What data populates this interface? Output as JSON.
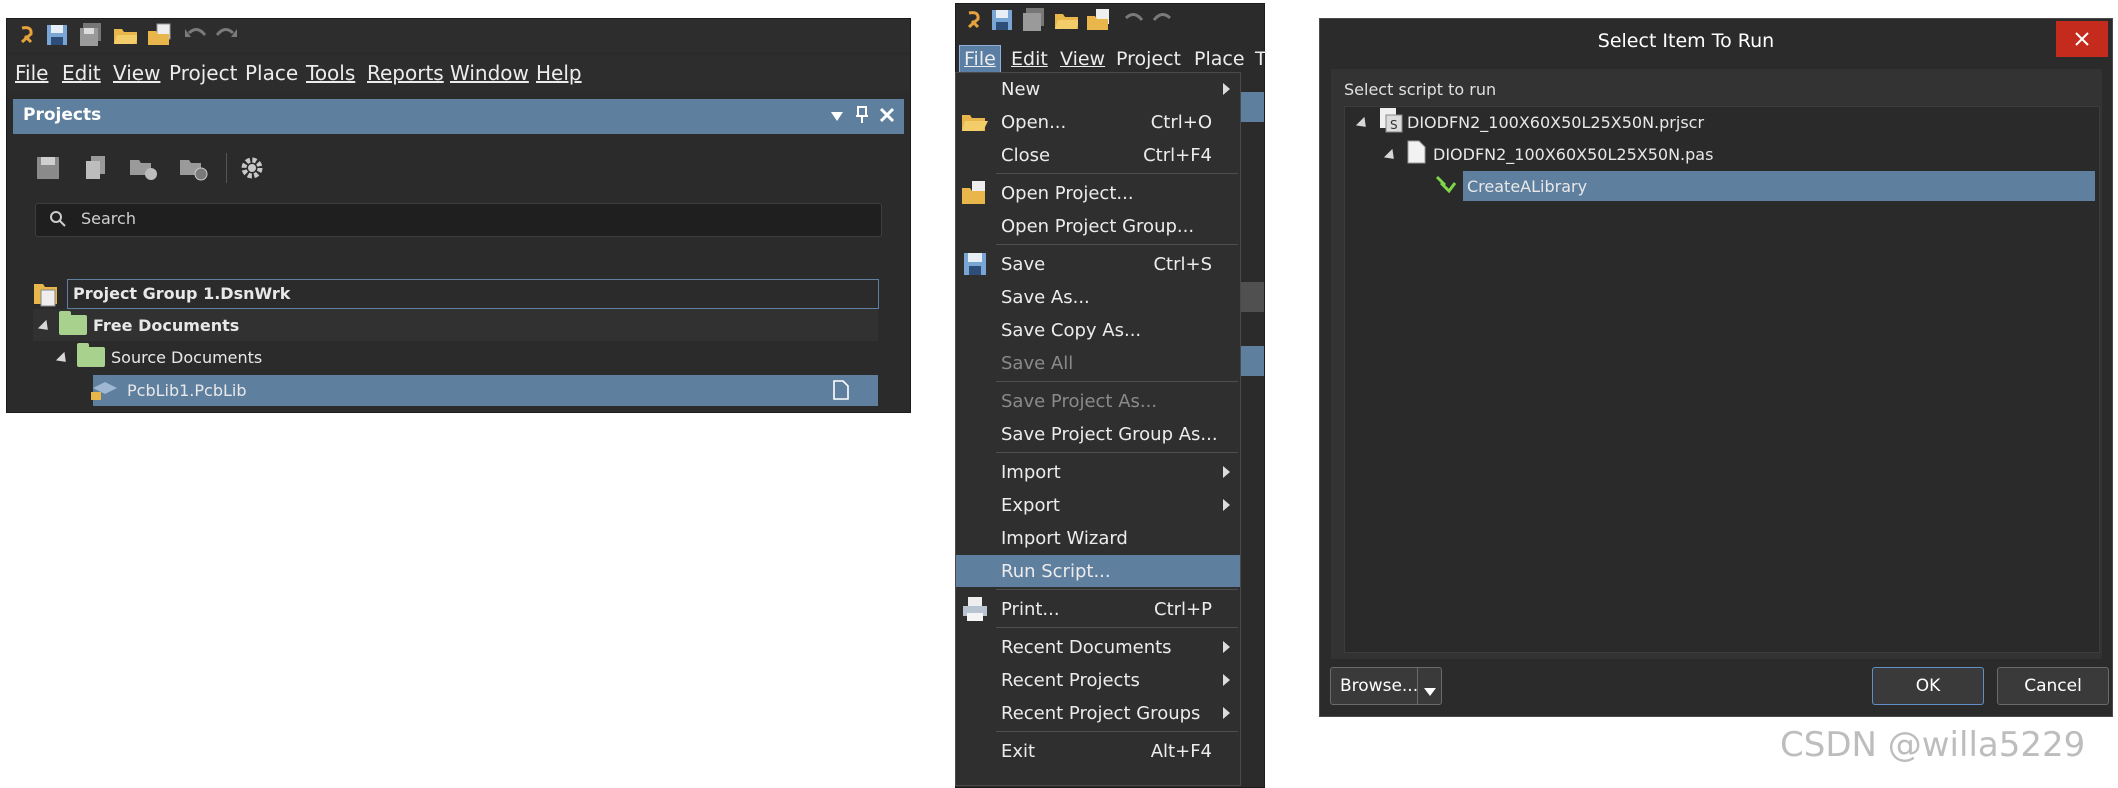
{
  "colors": {
    "accent": "#5f7f9f",
    "panel": "#2b2b2b",
    "close": "#c42b1c"
  },
  "panelA": {
    "toolbar_icons": [
      "altium-logo-icon",
      "save-icon",
      "save-all-icon",
      "open-folder-icon",
      "open-project-icon",
      "undo-icon",
      "redo-icon"
    ],
    "menu": [
      {
        "label": "File"
      },
      {
        "label": "Edit"
      },
      {
        "label": "View"
      },
      {
        "label": "Project"
      },
      {
        "label": "Place"
      },
      {
        "label": "Tools"
      },
      {
        "label": "Reports"
      },
      {
        "label": "Window"
      },
      {
        "label": "Help"
      }
    ],
    "projects_title": "Projects",
    "search_placeholder": "Search",
    "tree": {
      "group": "Project Group 1.DsnWrk",
      "free_docs": "Free Documents",
      "source_docs": "Source Documents",
      "file": "PcbLib1.PcbLib"
    }
  },
  "panelB": {
    "menu": [
      {
        "label": "File"
      },
      {
        "label": "Edit"
      },
      {
        "label": "View"
      },
      {
        "label": "Project"
      },
      {
        "label": "Place"
      },
      {
        "label": "T"
      }
    ],
    "file_menu": [
      {
        "label": "New",
        "shortcut": "",
        "submenu": true
      },
      {
        "label": "Open...",
        "shortcut": "Ctrl+O",
        "icon": "open-folder-icon"
      },
      {
        "label": "Close",
        "shortcut": "Ctrl+F4"
      },
      {
        "label": "Open Project...",
        "shortcut": "",
        "icon": "open-project-icon"
      },
      {
        "label": "Open Project Group...",
        "shortcut": ""
      },
      {
        "label": "Save",
        "shortcut": "Ctrl+S",
        "icon": "save-icon"
      },
      {
        "label": "Save As...",
        "shortcut": ""
      },
      {
        "label": "Save Copy As...",
        "shortcut": ""
      },
      {
        "label": "Save All",
        "shortcut": "",
        "disabled": true
      },
      {
        "label": "Save Project As...",
        "shortcut": "",
        "disabled": true
      },
      {
        "label": "Save Project Group As...",
        "shortcut": ""
      },
      {
        "label": "Import",
        "shortcut": "",
        "submenu": true
      },
      {
        "label": "Export",
        "shortcut": "",
        "submenu": true
      },
      {
        "label": "Import Wizard",
        "shortcut": ""
      },
      {
        "label": "Run Script...",
        "shortcut": "",
        "highlighted": true
      },
      {
        "label": "Print...",
        "shortcut": "Ctrl+P",
        "icon": "print-icon"
      },
      {
        "label": "Recent Documents",
        "shortcut": "",
        "submenu": true
      },
      {
        "label": "Recent Projects",
        "shortcut": "",
        "submenu": true
      },
      {
        "label": "Recent Project Groups",
        "shortcut": "",
        "submenu": true
      },
      {
        "label": "Exit",
        "shortcut": "Alt+F4"
      }
    ]
  },
  "dialog": {
    "title": "Select Item To Run",
    "label": "Select script to run",
    "tree": {
      "project": "DIODFN2_100X60X50L25X50N.prjscr",
      "unit": "DIODFN2_100X60X50L25X50N.pas",
      "procedure": "CreateALibrary"
    },
    "browse": "Browse...",
    "ok": "OK",
    "cancel": "Cancel"
  },
  "watermark": "CSDN @willa5229"
}
